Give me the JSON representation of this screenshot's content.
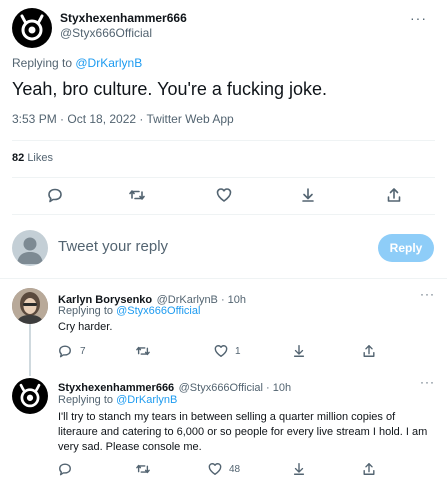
{
  "main_tweet": {
    "display_name": "Styxhexenhammer666",
    "handle": "@Styx666Official",
    "replying_prefix": "Replying to ",
    "replying_to": "@DrKarlynB",
    "text": "Yeah, bro culture. You're a fucking joke.",
    "time": "3:53 PM · Oct 18, 2022 · Twitter Web App",
    "likes_count": "82",
    "likes_label": "Likes",
    "more": "···"
  },
  "compose": {
    "placeholder": "Tweet your reply",
    "button": "Reply"
  },
  "replies": [
    {
      "display_name": "Karlyn Borysenko",
      "handle_time": "@DrKarlynB · 10h",
      "replying_prefix": "Replying to ",
      "replying_to": "@Styx666Official",
      "text": "Cry harder.",
      "reply_count": "7",
      "like_count": "1",
      "more": "···"
    },
    {
      "display_name": "Styxhexenhammer666",
      "handle_time": "@Styx666Official · 10h",
      "replying_prefix": "Replying to ",
      "replying_to": "@DrKarlynB",
      "text": "I'll try to stanch my tears in between selling a quarter million copies of literaure and catering to 6,000 or so people for every live stream I hold. I am very sad. Please console me.",
      "like_count": "48",
      "more": "···"
    }
  ],
  "icons": {
    "reply": "reply-icon",
    "retweet": "retweet-icon",
    "like": "heart-icon",
    "bookmark": "bookmark-icon",
    "share": "share-icon"
  },
  "colors": {
    "accent": "#1d9bf0",
    "reply_button_disabled": "#8ecdf8",
    "secondary_text": "#536471"
  }
}
